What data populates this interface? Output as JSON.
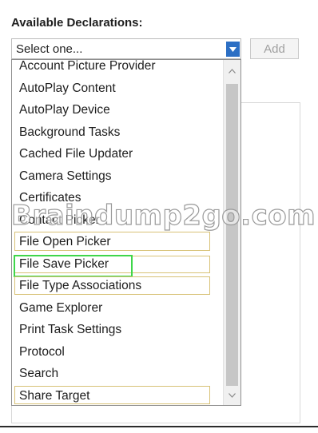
{
  "heading": "Available Declarations:",
  "combo": {
    "selected_text": "Select one...",
    "arrow_icon": "chevron-down-icon"
  },
  "add_button": {
    "label": "Add"
  },
  "dropdown": {
    "items": [
      "Account Picture Provider",
      "AutoPlay Content",
      "AutoPlay Device",
      "Background Tasks",
      "Cached File Updater",
      "Camera Settings",
      "Certificates",
      "Contact Picker",
      "File Open Picker",
      "File Save Picker",
      "File Type Associations",
      "Game Explorer",
      "Print Task Settings",
      "Protocol",
      "Search",
      "Share Target"
    ]
  },
  "watermark": "Braindump2go.com",
  "colors": {
    "accent": "#2c6fc4",
    "highlight_yellow": "#d8c277",
    "highlight_green": "#3fd64a"
  }
}
